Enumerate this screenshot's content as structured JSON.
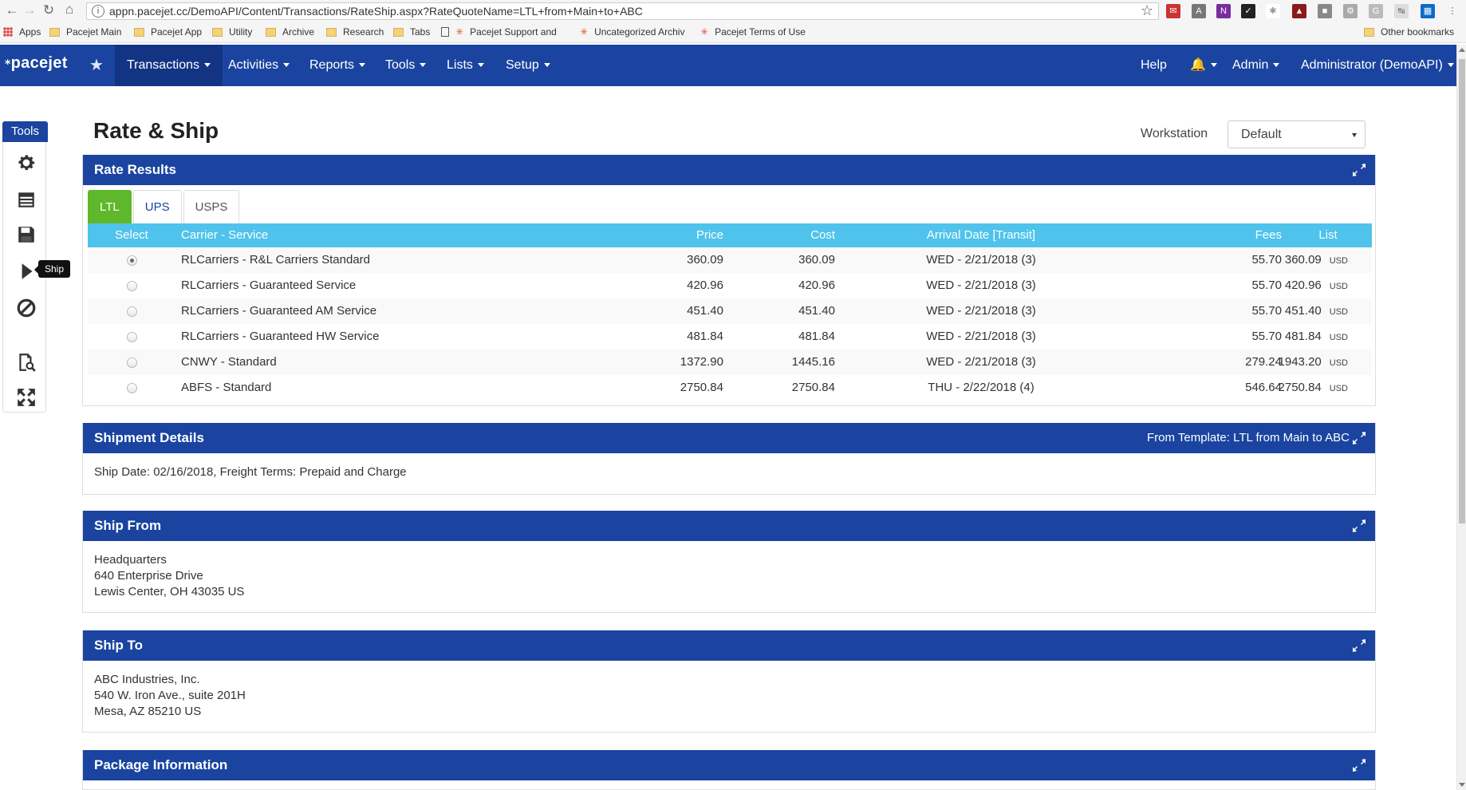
{
  "browser": {
    "url": "appn.pacejet.cc/DemoAPI/Content/Transactions/RateShip.aspx?RateQuoteName=LTL+from+Main+to+ABC",
    "bookmarks": [
      "Apps",
      "Pacejet Main",
      "Pacejet App",
      "Utility",
      "Archive",
      "Research",
      "Tabs",
      "Pacejet Support and",
      "Uncategorized Archiv",
      "Pacejet Terms of Use"
    ],
    "other_bookmarks": "Other bookmarks"
  },
  "nav": {
    "logo": "pacejet",
    "menus": [
      "Transactions",
      "Activities",
      "Reports",
      "Tools",
      "Lists",
      "Setup"
    ],
    "help": "Help",
    "admin": "Admin",
    "user": "Administrator (DemoAPI)"
  },
  "tools": {
    "header": "Tools",
    "tooltip": "Ship",
    "icons": [
      "gear-icon",
      "calendar-icon",
      "save-icon",
      "play-icon",
      "cancel-icon",
      "document-search-icon",
      "fullscreen-icon"
    ]
  },
  "page": {
    "title": "Rate & Ship",
    "workstation_label": "Workstation",
    "workstation_value": "Default"
  },
  "rate_results": {
    "title": "Rate Results",
    "tabs": [
      "LTL",
      "UPS",
      "USPS"
    ],
    "columns": [
      "Select",
      "Carrier - Service",
      "Price",
      "Cost",
      "Arrival Date [Transit]",
      "Fees",
      "List"
    ],
    "rows": [
      {
        "carrier": "RLCarriers - R&L Carriers Standard",
        "price": "360.09",
        "cost": "360.09",
        "arrival": "WED - 2/21/2018 (3)",
        "fees": "55.70",
        "list": "360.09",
        "currency": "USD",
        "selected": true
      },
      {
        "carrier": "RLCarriers - Guaranteed Service",
        "price": "420.96",
        "cost": "420.96",
        "arrival": "WED - 2/21/2018 (3)",
        "fees": "55.70",
        "list": "420.96",
        "currency": "USD",
        "selected": false
      },
      {
        "carrier": "RLCarriers - Guaranteed AM Service",
        "price": "451.40",
        "cost": "451.40",
        "arrival": "WED - 2/21/2018 (3)",
        "fees": "55.70",
        "list": "451.40",
        "currency": "USD",
        "selected": false
      },
      {
        "carrier": "RLCarriers - Guaranteed HW Service",
        "price": "481.84",
        "cost": "481.84",
        "arrival": "WED - 2/21/2018 (3)",
        "fees": "55.70",
        "list": "481.84",
        "currency": "USD",
        "selected": false
      },
      {
        "carrier": "CNWY - Standard",
        "price": "1372.90",
        "cost": "1445.16",
        "arrival": "WED - 2/21/2018 (3)",
        "fees": "279.24",
        "list": "1943.20",
        "currency": "USD",
        "selected": false
      },
      {
        "carrier": "ABFS - Standard",
        "price": "2750.84",
        "cost": "2750.84",
        "arrival": "THU - 2/22/2018 (4)",
        "fees": "546.64",
        "list": "2750.84",
        "currency": "USD",
        "selected": false
      }
    ]
  },
  "shipment_details": {
    "title": "Shipment Details",
    "template": "From Template: LTL from Main to ABC",
    "body": "Ship Date: 02/16/2018, Freight Terms: Prepaid and Charge"
  },
  "ship_from": {
    "title": "Ship From",
    "lines": [
      "Headquarters",
      "640 Enterprise Drive",
      "Lewis Center, OH 43035 US"
    ]
  },
  "ship_to": {
    "title": "Ship To",
    "lines": [
      "ABC Industries, Inc.",
      "540 W. Iron Ave., suite 201H",
      "Mesa, AZ 85210 US"
    ]
  },
  "package_info": {
    "title": "Package Information"
  },
  "colors": {
    "nav_blue": "#1a44a0",
    "table_header": "#4fc3ec",
    "active_tab": "#5fb82b"
  }
}
